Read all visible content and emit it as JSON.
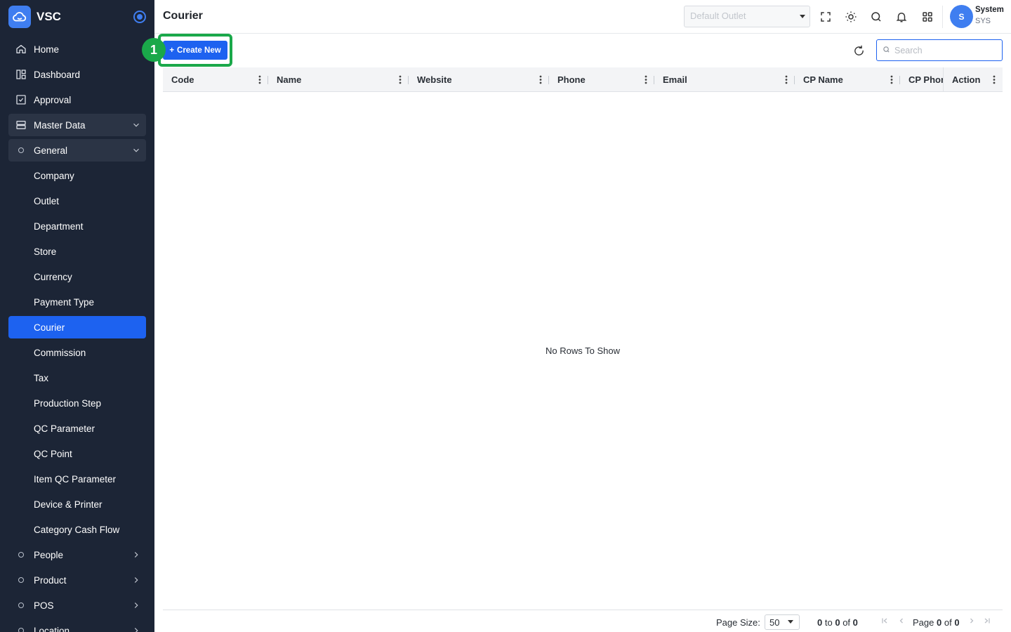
{
  "app": {
    "name": "VSC"
  },
  "sidebar": {
    "items": [
      {
        "label": "Home"
      },
      {
        "label": "Dashboard"
      },
      {
        "label": "Approval"
      },
      {
        "label": "Master Data"
      },
      {
        "label": "General"
      },
      {
        "label": "Company"
      },
      {
        "label": "Outlet"
      },
      {
        "label": "Department"
      },
      {
        "label": "Store"
      },
      {
        "label": "Currency"
      },
      {
        "label": "Payment Type"
      },
      {
        "label": "Courier"
      },
      {
        "label": "Commission"
      },
      {
        "label": "Tax"
      },
      {
        "label": "Production Step"
      },
      {
        "label": "QC Parameter"
      },
      {
        "label": "QC Point"
      },
      {
        "label": "Item QC Parameter"
      },
      {
        "label": "Device & Printer"
      },
      {
        "label": "Category Cash Flow"
      },
      {
        "label": "People"
      },
      {
        "label": "Product"
      },
      {
        "label": "POS"
      },
      {
        "label": "Location"
      }
    ]
  },
  "header": {
    "title": "Courier",
    "outlet_placeholder": "Default Outlet",
    "user": {
      "initial": "S",
      "name": "System",
      "code": "SYS"
    }
  },
  "toolbar": {
    "create_label": "Create New",
    "search_placeholder": "Search"
  },
  "annotation": {
    "step": "1",
    "color": "#1aa84a"
  },
  "grid": {
    "columns": [
      "Code",
      "Name",
      "Website",
      "Phone",
      "Email",
      "CP Name",
      "CP Phone",
      "Action"
    ],
    "empty_text": "No Rows To Show"
  },
  "footer": {
    "page_size_label": "Page Size:",
    "page_size": "50",
    "range_from": "0",
    "range_to_word": "to",
    "range_to": "0",
    "range_of_word": "of",
    "range_total": "0",
    "page_word": "Page",
    "page_current": "0",
    "page_of_word": "of",
    "page_total": "0"
  },
  "colors": {
    "sidebar_bg": "#1c2536",
    "accent": "#1d62f0",
    "highlight": "#1aa84a"
  }
}
